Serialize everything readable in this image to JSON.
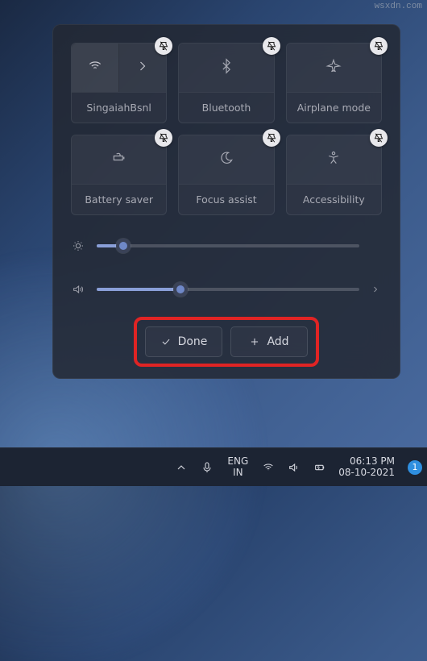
{
  "watermark": "wsxdn.com",
  "panel": {
    "tiles": [
      {
        "name": "wifi",
        "label": "SingaiahBsnl",
        "split": true
      },
      {
        "name": "bluetooth",
        "label": "Bluetooth",
        "split": false
      },
      {
        "name": "airplane",
        "label": "Airplane mode",
        "split": false
      },
      {
        "name": "battery-saver",
        "label": "Battery saver",
        "split": false
      },
      {
        "name": "focus-assist",
        "label": "Focus assist",
        "split": false
      },
      {
        "name": "accessibility",
        "label": "Accessibility",
        "split": false
      }
    ],
    "brightness_pct": 10,
    "volume_pct": 32,
    "buttons": {
      "done": "Done",
      "add": "Add"
    }
  },
  "taskbar": {
    "lang_top": "ENG",
    "lang_bottom": "IN",
    "time": "06:13 PM",
    "date": "08-10-2021",
    "notif_count": "1"
  }
}
